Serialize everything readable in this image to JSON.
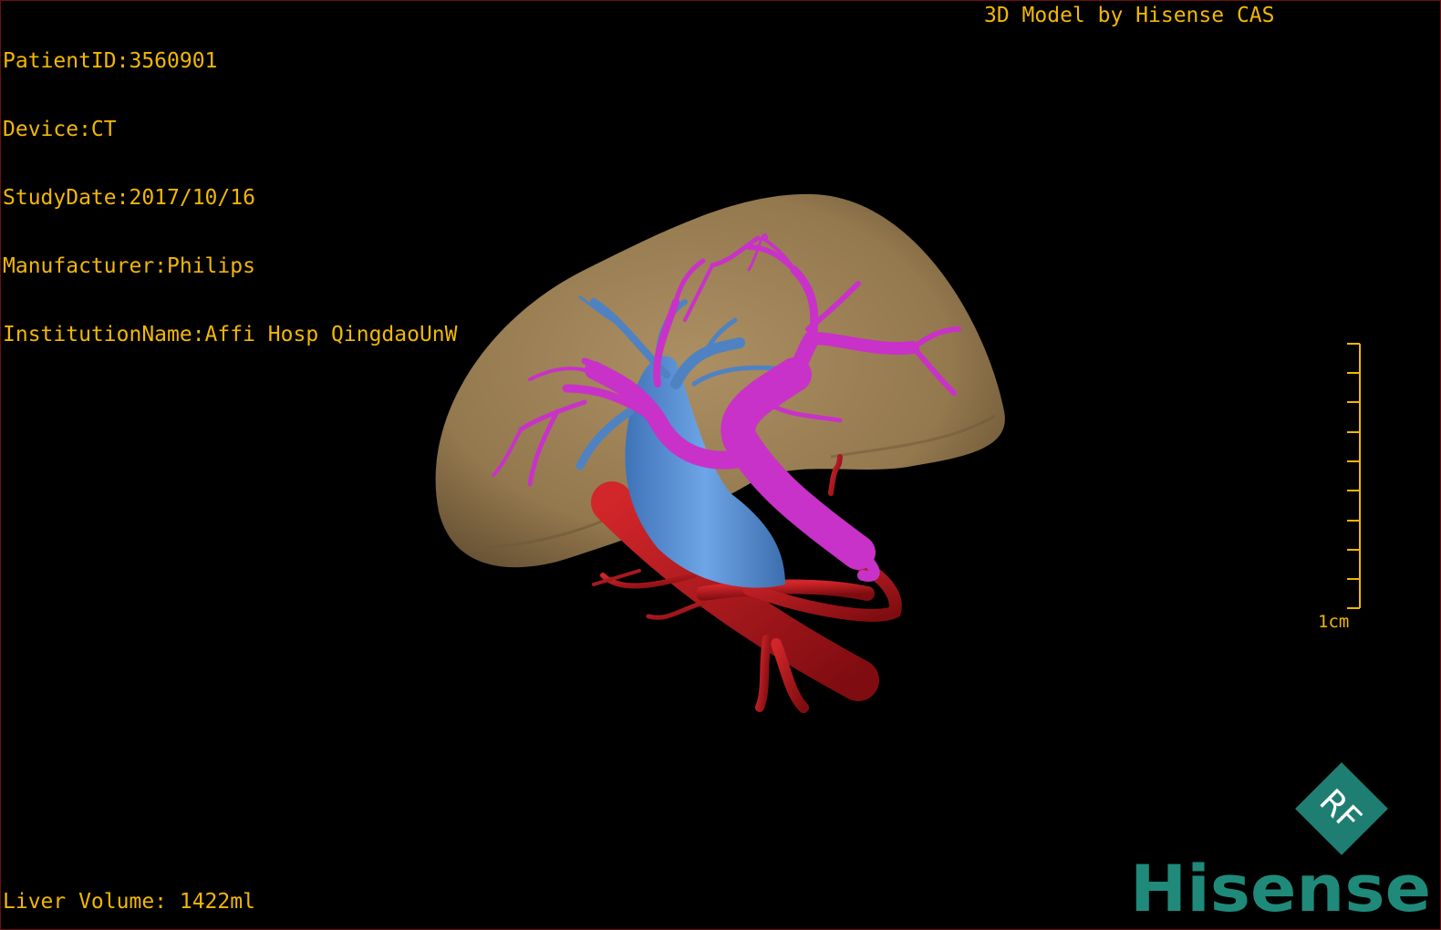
{
  "patient_info": {
    "patient_id": "PatientID:3560901",
    "device": "Device:CT",
    "study_date": "StudyDate:2017/10/16",
    "manufacturer": "Manufacturer:Philips",
    "institution": "InstitutionName:Affi Hosp QingdaoUnW"
  },
  "vendor_label": "3D Model by Hisense CAS",
  "liver_volume": "Liver Volume: 1422ml",
  "scale": {
    "label": "1cm"
  },
  "logo": {
    "diamond_text": "RF",
    "wordmark": "Hisense",
    "color": "#1f8a7a"
  },
  "colors": {
    "overlay_text": "#f2b705",
    "liver": "#a88a5c",
    "portal_vein": "#cc33cc",
    "hepatic_vein": "#5f97d9",
    "artery": "#b0161a"
  }
}
